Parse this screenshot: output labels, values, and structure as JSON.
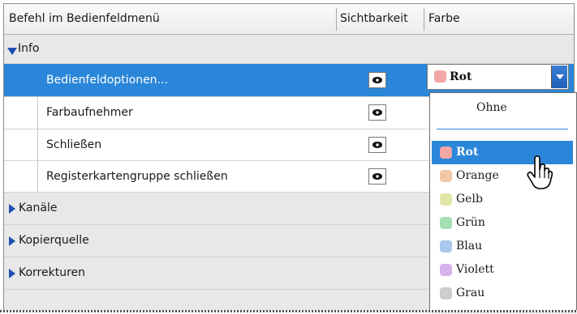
{
  "header": {
    "col_command": "Befehl im Bedienfeldmenü",
    "col_visibility": "Sichtbarkeit",
    "col_color": "Farbe"
  },
  "groups": {
    "info": {
      "label": "Info",
      "expanded": true
    },
    "kanaele": {
      "label": "Kanäle",
      "expanded": false
    },
    "kopierquelle": {
      "label": "Kopierquelle",
      "expanded": false
    },
    "korrekturen": {
      "label": "Korrekturen",
      "expanded": false
    }
  },
  "info_items": [
    {
      "label": "Bedienfeldoptionen...",
      "visible": true,
      "selected": true
    },
    {
      "label": "Farbaufnehmer",
      "visible": true,
      "selected": false
    },
    {
      "label": "Schließen",
      "visible": true,
      "selected": false
    },
    {
      "label": "Registerkartengruppe schließen",
      "visible": true,
      "selected": false
    }
  ],
  "color_select": {
    "value": "Rot",
    "swatch": "#f4a6a6"
  },
  "color_options": [
    {
      "label": "Ohne",
      "swatch": ""
    },
    {
      "label": "Rot",
      "swatch": "#f4a6a6",
      "highlighted": true
    },
    {
      "label": "Orange",
      "swatch": "#f2c9a4"
    },
    {
      "label": "Gelb",
      "swatch": "#e2e7a8"
    },
    {
      "label": "Grün",
      "swatch": "#a3dfb0"
    },
    {
      "label": "Blau",
      "swatch": "#a9c8ec"
    },
    {
      "label": "Violett",
      "swatch": "#d6b1ec"
    },
    {
      "label": "Grau",
      "swatch": "#cdcdcd"
    }
  ],
  "colors": {
    "selection": "#2a86d8",
    "triangle": "#1f4fb3"
  }
}
